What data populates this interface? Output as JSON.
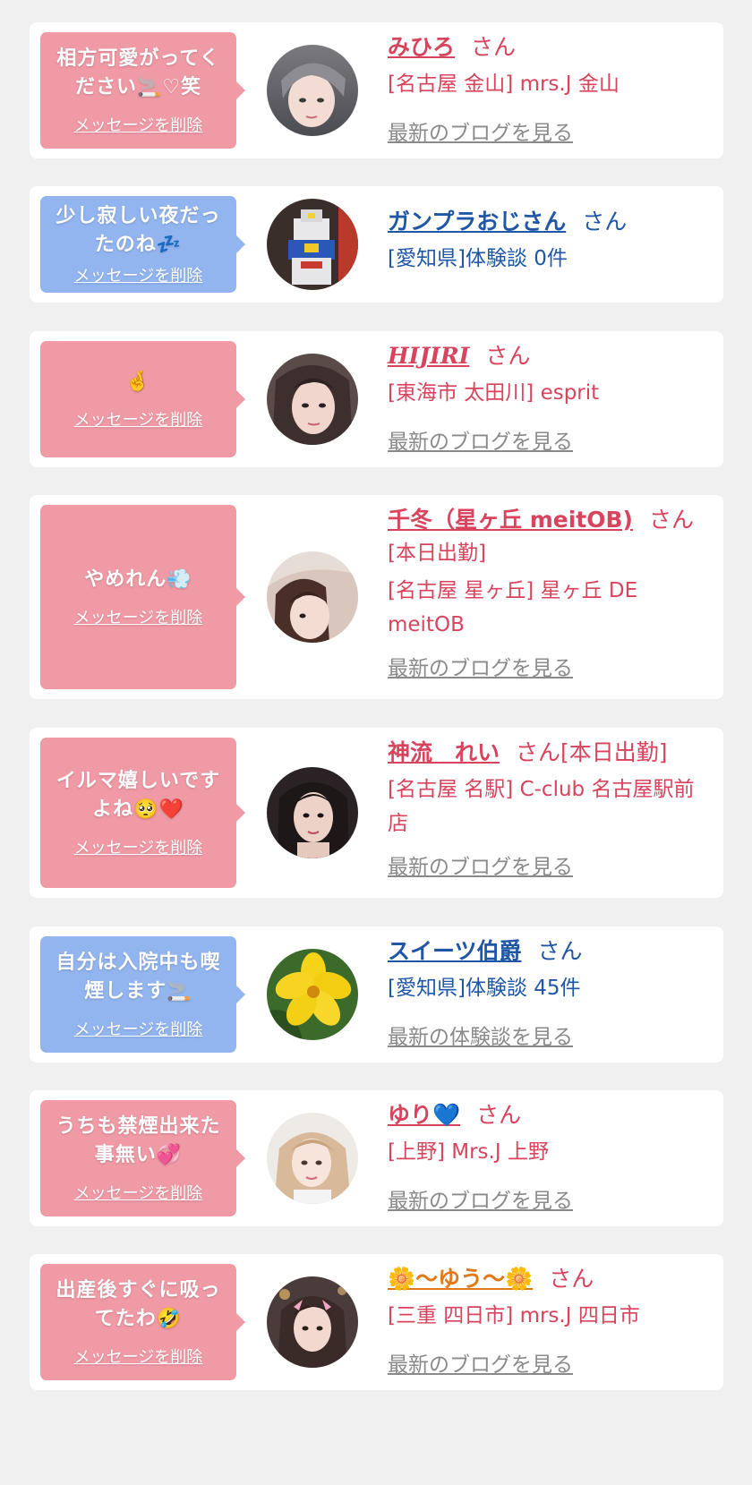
{
  "colors": {
    "page_bg": "#f0f0f1",
    "card_bg": "#ffffff",
    "bubble_pink": "#ef9aa5",
    "bubble_blue": "#92b5ef",
    "name_pink": "#d8445d",
    "name_blue": "#1f57a6",
    "blog_gray": "#8a8a8a"
  },
  "delete_label": "メッセージを削除",
  "blog_label": "最新のブログを見る",
  "experience_label": "最新の体験談を見る",
  "san_suffix": "さん",
  "messages": [
    {
      "bubble_color": "pink",
      "text": "相方可愛がってください🚬♡笑",
      "avatar_icon": "avatar-photo",
      "name": "みひろ",
      "san": "さん",
      "details": [
        "[名古屋 金山] mrs.J 金山"
      ],
      "link": "最新のブログを見る"
    },
    {
      "bubble_color": "blue",
      "text": "少し寂しい夜だったのね💤",
      "avatar_icon": "gundam-robot-photo",
      "name": "ガンプラおじさん",
      "san": "さん",
      "details": [
        "[愛知県]体験談 0件"
      ],
      "link": ""
    },
    {
      "bubble_color": "pink",
      "text": "🤞",
      "avatar_icon": "avatar-photo",
      "name": "HIJIRI",
      "san": "さん",
      "details": [
        "[東海市 太田川] esprit"
      ],
      "link": "最新のブログを見る"
    },
    {
      "bubble_color": "pink",
      "text": "やめれん💨",
      "avatar_icon": "avatar-photo",
      "name": "千冬（星ヶ丘 meitOB)",
      "san": "さん",
      "details": [
        "[本日出勤]",
        "[名古屋 星ヶ丘] 星ヶ丘 DE meitOB"
      ],
      "link": "最新のブログを見る"
    },
    {
      "bubble_color": "pink",
      "text": "イルマ嬉しいですよね🥺❤️",
      "avatar_icon": "avatar-photo",
      "name": "神流　れい",
      "san": "さん[本日出勤]",
      "details": [
        "[名古屋 名駅] C-club 名古屋駅前店"
      ],
      "link": "最新のブログを見る"
    },
    {
      "bubble_color": "blue",
      "text": "自分は入院中も喫煙します🚬",
      "avatar_icon": "yellow-flower-photo",
      "name": "スイーツ伯爵",
      "san": "さん",
      "details": [
        "[愛知県]体験談 45件"
      ],
      "link": "最新の体験談を見る"
    },
    {
      "bubble_color": "pink",
      "text": "うちも禁煙出来た事無い💞",
      "avatar_icon": "avatar-photo",
      "name": "ゆり💙",
      "san": "さん",
      "details": [
        "[上野] Mrs.J 上野"
      ],
      "link": "最新のブログを見る"
    },
    {
      "bubble_color": "pink",
      "text": "出産後すぐに吸ってたわ🤣",
      "avatar_icon": "avatar-photo",
      "name": "🌼〜ゆう〜🌼",
      "san": "さん",
      "details": [
        "[三重 四日市] mrs.J 四日市"
      ],
      "link": "最新のブログを見る"
    }
  ]
}
